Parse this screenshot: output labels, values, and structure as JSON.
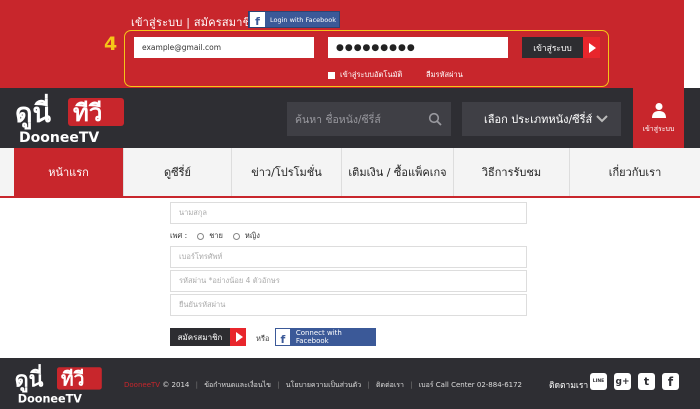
{
  "login": {
    "title": "เข้าสู่ระบบ | สมัครสมาชิก",
    "fb_login_label": "Login with Facebook",
    "fb_glyph": "f",
    "step_number": "4",
    "email_value": "example@gmail.com",
    "password_value": "●●●●●●●●●",
    "login_button_label": "เข้าสู่ระบบ",
    "remember_label": "เข้าสู่ระบบอัตโนมัติ",
    "forgot_label": "ลืมรหัสผ่าน"
  },
  "header": {
    "search_placeholder": "ค้นหา ชื่อหนัง/ซีรี่ส์",
    "category_label": "เลือก ประเภทหนัง/ซีรี่ส์",
    "user_label": "เข้าสู่ระบบ",
    "logo_text_top_left": "ดูนี่",
    "logo_text_top_right": "ทีวี",
    "logo_text_bottom": "DooneeTV"
  },
  "nav": {
    "items": [
      {
        "label": "หน้าแรก"
      },
      {
        "label": "ดูซีรี่ย์"
      },
      {
        "label": "ข่าว/โปรโมชั่น"
      },
      {
        "label": "เติมเงิน / ซื้อแพ็คเกจ"
      },
      {
        "label": "วิธีการรับชม"
      },
      {
        "label": "เกี่ยวกับเรา"
      }
    ]
  },
  "form": {
    "surname_placeholder": "นามสกุล",
    "gender_label": "เพศ :",
    "gender_male": "ชาย",
    "gender_female": "หญิง",
    "phone_placeholder": "เบอร์โทรศัพท์",
    "password_placeholder": "รหัสผ่าน *อย่างน้อย 4 ตัวอักษร",
    "confirm_placeholder": "ยืนยันรหัสผ่าน",
    "register_label": "สมัครสมาชิก",
    "or_label": "หรือ",
    "fb_connect_label": "Connect with Facebook"
  },
  "footer": {
    "brand": "DooneeTV",
    "copyright": "© 2014",
    "links": [
      "ข้อกำหนดและเงื่อนไข",
      "นโยบายความเป็นส่วนตัว",
      "ติดต่อเรา",
      "เบอร์ Call Center 02-884-6172"
    ],
    "follow_label": "ติดตามเรา",
    "social": [
      {
        "icon": "line-icon",
        "glyph": "LINE"
      },
      {
        "icon": "google-plus-icon",
        "glyph": "g+"
      },
      {
        "icon": "twitter-icon",
        "glyph": "t"
      },
      {
        "icon": "facebook-icon",
        "glyph": "f"
      }
    ]
  },
  "colors": {
    "brand_red": "#c8262c",
    "dark": "#2e2e33",
    "highlight": "#f5c518",
    "facebook": "#3b5998"
  }
}
